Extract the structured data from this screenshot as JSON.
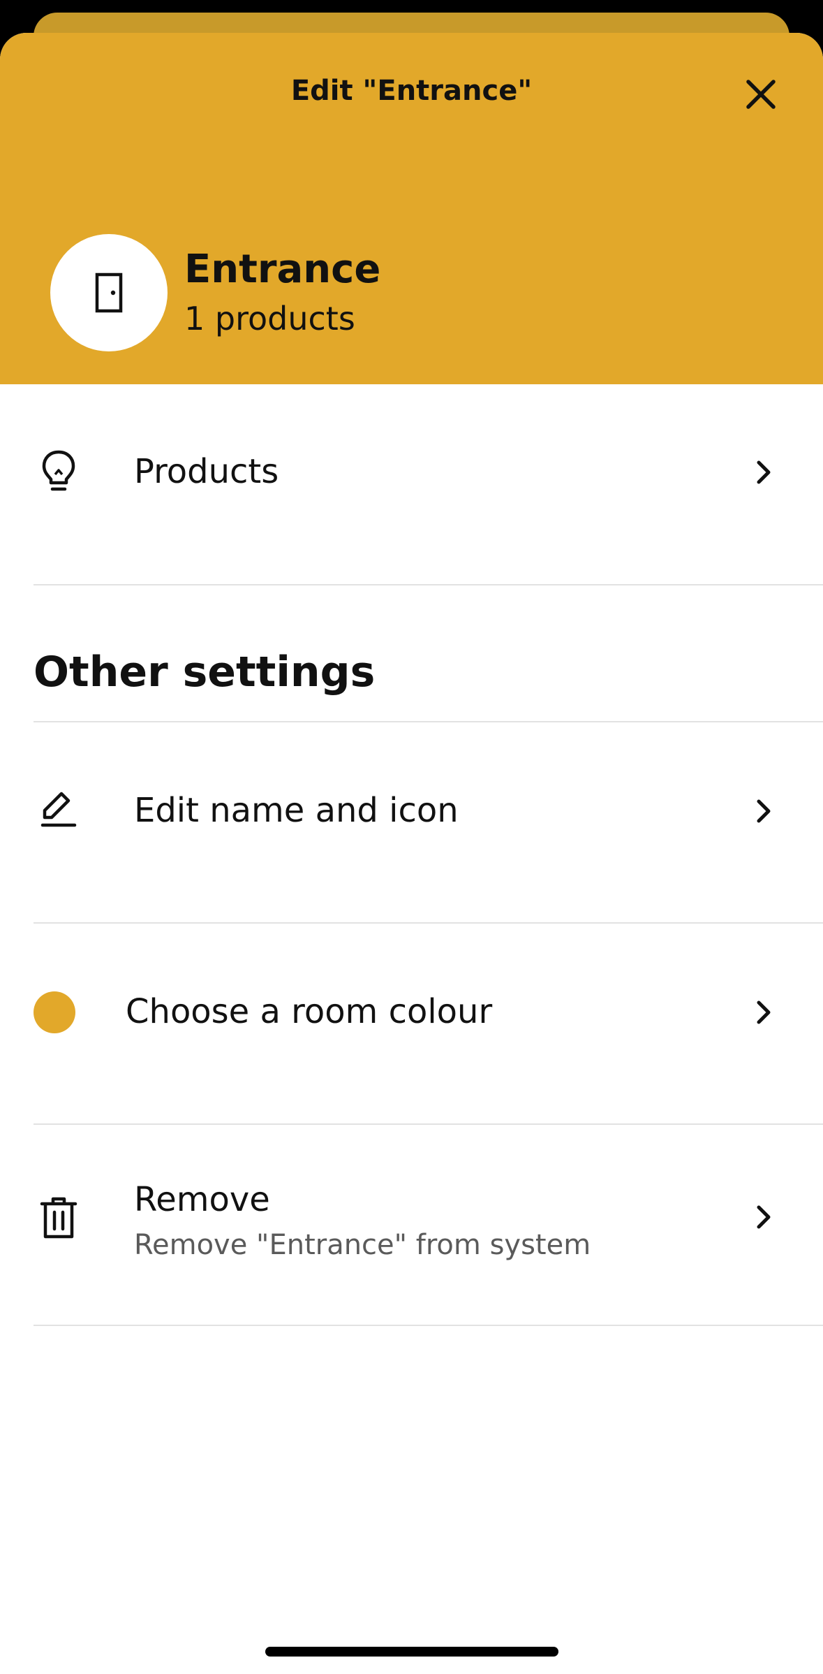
{
  "header": {
    "title": "Edit \"Entrance\"",
    "close_icon": "close-icon",
    "room_icon": "door-icon",
    "room_name": "Entrance",
    "room_sub": "1 products",
    "accent_color": "#e2a82a"
  },
  "products_row": {
    "label": "Products",
    "icon": "lightbulb-icon"
  },
  "other_settings": {
    "title": "Other settings",
    "items": [
      {
        "label": "Edit name and icon",
        "icon": "pencil-icon"
      },
      {
        "label": "Choose a room colour",
        "icon": "colour-dot-icon",
        "color": "#e2a82a"
      },
      {
        "label": "Remove",
        "sublabel": "Remove \"Entrance\" from system",
        "icon": "trash-icon"
      }
    ]
  }
}
